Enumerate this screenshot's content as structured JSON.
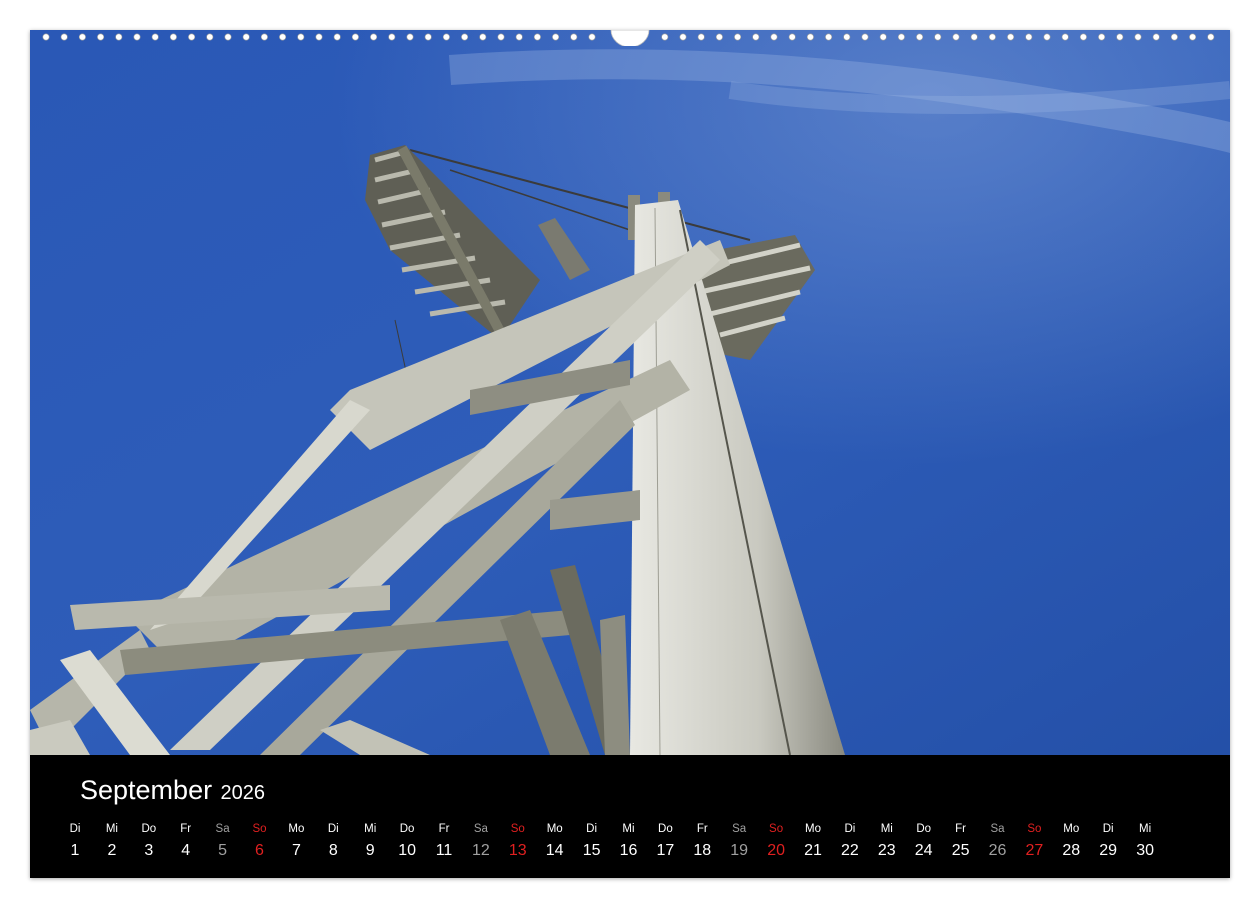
{
  "calendar": {
    "month": "September",
    "year": "2026",
    "days": [
      {
        "wd": "Di",
        "d": "1"
      },
      {
        "wd": "Mi",
        "d": "2"
      },
      {
        "wd": "Do",
        "d": "3"
      },
      {
        "wd": "Fr",
        "d": "4"
      },
      {
        "wd": "Sa",
        "d": "5"
      },
      {
        "wd": "So",
        "d": "6"
      },
      {
        "wd": "Mo",
        "d": "7"
      },
      {
        "wd": "Di",
        "d": "8"
      },
      {
        "wd": "Mi",
        "d": "9"
      },
      {
        "wd": "Do",
        "d": "10"
      },
      {
        "wd": "Fr",
        "d": "11"
      },
      {
        "wd": "Sa",
        "d": "12"
      },
      {
        "wd": "So",
        "d": "13"
      },
      {
        "wd": "Mo",
        "d": "14"
      },
      {
        "wd": "Di",
        "d": "15"
      },
      {
        "wd": "Mi",
        "d": "16"
      },
      {
        "wd": "Do",
        "d": "17"
      },
      {
        "wd": "Fr",
        "d": "18"
      },
      {
        "wd": "Sa",
        "d": "19"
      },
      {
        "wd": "So",
        "d": "20"
      },
      {
        "wd": "Mo",
        "d": "21"
      },
      {
        "wd": "Di",
        "d": "22"
      },
      {
        "wd": "Mi",
        "d": "23"
      },
      {
        "wd": "Do",
        "d": "24"
      },
      {
        "wd": "Fr",
        "d": "25"
      },
      {
        "wd": "Sa",
        "d": "26"
      },
      {
        "wd": "So",
        "d": "27"
      },
      {
        "wd": "Mo",
        "d": "28"
      },
      {
        "wd": "Di",
        "d": "29"
      },
      {
        "wd": "Mi",
        "d": "30"
      }
    ]
  },
  "colors": {
    "sky": "#2d5bb4",
    "caption_bg": "#000000",
    "sunday": "#e02020",
    "saturday": "#a0a0a0",
    "weekday": "#ffffff"
  },
  "photo": {
    "subject": "wooden-summit-cross-icon"
  }
}
